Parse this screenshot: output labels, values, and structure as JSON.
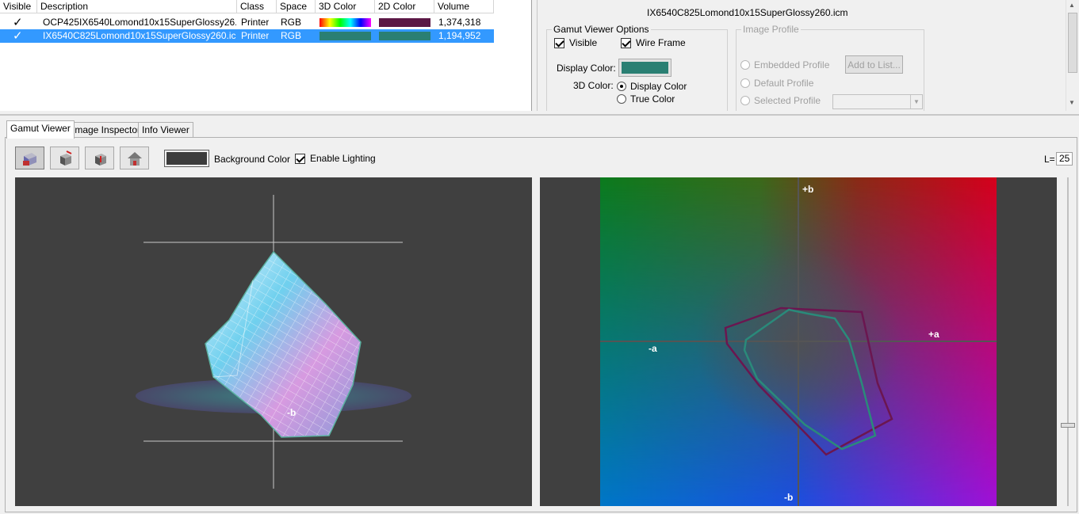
{
  "list": {
    "columns": [
      "Visible",
      "Description",
      "Class",
      "Space",
      "3D Color",
      "2D Color",
      "Volume"
    ],
    "rows": [
      {
        "visible": "✓",
        "description": "OCP425IX6540Lomond10x15SuperGlossy26...",
        "class": "Printer",
        "space": "RGB",
        "color3d": "rainbow",
        "color2d": "#5b1745",
        "volume": "1,374,318"
      },
      {
        "visible": "✓",
        "description": "IX6540C825Lomond10x15SuperGlossy260.ic...",
        "class": "Printer",
        "space": "RGB",
        "color3d": "#2a7f73",
        "color2d": "#2a7f73",
        "volume": "1,194,952"
      }
    ]
  },
  "options": {
    "profile_title": "IX6540C825Lomond10x15SuperGlossy260.icm",
    "gamut_group_title": "Gamut Viewer Options",
    "visible_label": "Visible",
    "wireframe_label": "Wire Frame",
    "display_color_label": "Display Color:",
    "display_color_value": "#2a7f73",
    "color3d_label": "3D Color:",
    "radio_display_color": "Display Color",
    "radio_true_color": "True Color",
    "image_profile_title": "Image Profile",
    "embedded_profile": "Embedded Profile",
    "default_profile": "Default Profile",
    "selected_profile": "Selected Profile",
    "add_to_list": "Add to List..."
  },
  "tabs": [
    "Gamut Viewer",
    "Image Inspector",
    "Info Viewer"
  ],
  "toolbar": {
    "background_color_label": "Background Color",
    "enable_lighting_label": "Enable Lighting",
    "l_label": "L=",
    "l_value": "25"
  },
  "plot2d": {
    "plus_b": "+b",
    "minus_b": "-b",
    "plus_a": "+a",
    "minus_a": "-a",
    "outline_colors": {
      "profile1": "#6b1650",
      "profile2": "#2a8a7a"
    }
  },
  "plot3d": {
    "minus_b": "-b"
  },
  "colors": {
    "selection": "#3399ff",
    "viewer_background": "#404040"
  }
}
